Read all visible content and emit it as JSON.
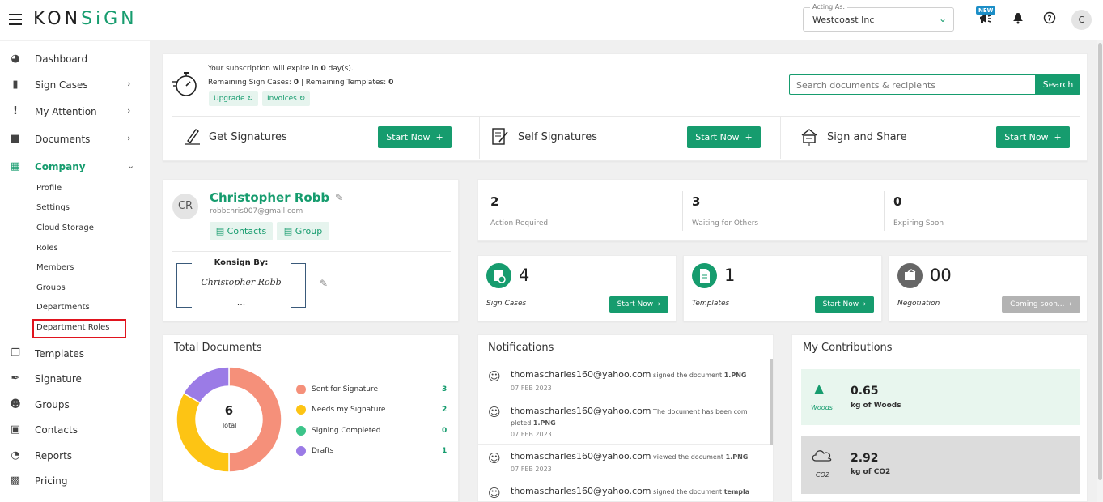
{
  "header": {
    "logo_k": "K",
    "logo_o": "O",
    "logo_n": "N",
    "logo_s": "S",
    "logo_i": "i",
    "logo_gn": "GN",
    "acting_label": "Acting As:",
    "acting_value": "Westcoast Inc",
    "new_badge": "NEW",
    "avatar_initial": "C"
  },
  "sidebar": {
    "items": [
      {
        "label": "Dashboard",
        "icon": "dashboard-icon"
      },
      {
        "label": "Sign Cases",
        "icon": "briefcase-icon"
      },
      {
        "label": "My Attention",
        "icon": "exclamation-icon"
      },
      {
        "label": "Documents",
        "icon": "folder-icon"
      },
      {
        "label": "Company",
        "icon": "building-icon"
      },
      {
        "label": "Templates",
        "icon": "copy-icon"
      },
      {
        "label": "Signature",
        "icon": "pen-icon"
      },
      {
        "label": "Groups",
        "icon": "users-icon"
      },
      {
        "label": "Contacts",
        "icon": "contact-card-icon"
      },
      {
        "label": "Reports",
        "icon": "pie-chart-icon"
      },
      {
        "label": "Pricing",
        "icon": "money-icon"
      }
    ],
    "company_sub": [
      "Profile",
      "Settings",
      "Cloud Storage",
      "Roles",
      "Members",
      "Groups",
      "Departments",
      "Department Roles"
    ]
  },
  "subscription": {
    "line1_pre": "Your subscription will expire in ",
    "line1_bold": "0",
    "line1_post": " day(s).",
    "line2_a": "Remaining Sign Cases: ",
    "line2_a_val": "0",
    "line2_b": " | Remaining Templates: ",
    "line2_b_val": "0",
    "upgrade": "Upgrade",
    "invoices": "Invoices",
    "search_placeholder": "Search documents & recipients",
    "search_button": "Search"
  },
  "actions": [
    {
      "label": "Get Signatures",
      "button": "Start Now"
    },
    {
      "label": "Self Signatures",
      "button": "Start Now"
    },
    {
      "label": "Sign and Share",
      "button": "Start Now"
    }
  ],
  "profile": {
    "initials": "CR",
    "name": "Christopher Robb",
    "email": "robbchris007@gmail.com",
    "contacts": "Contacts",
    "group": "Group",
    "konsign_by": "Konsign By:",
    "signature": "Christopher Robb",
    "ellipsis": "..."
  },
  "stats": [
    {
      "value": "2",
      "label": "Action Required"
    },
    {
      "value": "3",
      "label": "Waiting for Others"
    },
    {
      "value": "0",
      "label": "Expiring Soon"
    }
  ],
  "tiles": [
    {
      "value": "4",
      "label": "Sign Cases",
      "button": "Start Now",
      "icon": "sign-case-icon",
      "color": "#169c6e"
    },
    {
      "value": "1",
      "label": "Templates",
      "button": "Start Now",
      "icon": "template-icon",
      "color": "#169c6e"
    },
    {
      "value": "00",
      "label": "Negotiation",
      "button": "Coming soon...",
      "icon": "negotiation-icon",
      "color": "#666666"
    }
  ],
  "total_documents": {
    "title": "Total Documents",
    "center_value": "6",
    "center_label": "Total",
    "legend": [
      {
        "label": "Sent for Signature",
        "value": "3",
        "color": "#f5907a"
      },
      {
        "label": "Needs my Signature",
        "value": "2",
        "color": "#fdc414"
      },
      {
        "label": "Signing Completed",
        "value": "0",
        "color": "#3cc48a"
      },
      {
        "label": "Drafts",
        "value": "1",
        "color": "#9b7be6"
      }
    ]
  },
  "notifications": {
    "title": "Notifications",
    "items": [
      {
        "email": "thomascharles160@yahoo.com",
        "text": " signed the document ",
        "doc": "1.PNG",
        "date": "07 FEB 2023"
      },
      {
        "email": "thomascharles160@yahoo.com",
        "text": " The document has been com pleted ",
        "doc": "1.PNG",
        "date": "07 FEB 2023"
      },
      {
        "email": "thomascharles160@yahoo.com",
        "text": " viewed the document ",
        "doc": "1.PNG",
        "date": "07 FEB 2023"
      },
      {
        "email": "thomascharles160@yahoo.com",
        "text": " signed the document ",
        "doc": "templa",
        "date": ""
      }
    ]
  },
  "contributions": {
    "title": "My Contributions",
    "woods_value": "0.65",
    "woods_label": "kg of Woods",
    "woods_icon_label": "Woods",
    "co2_value": "2.92",
    "co2_label": "kg of CO2",
    "co2_icon_label": "CO2"
  }
}
